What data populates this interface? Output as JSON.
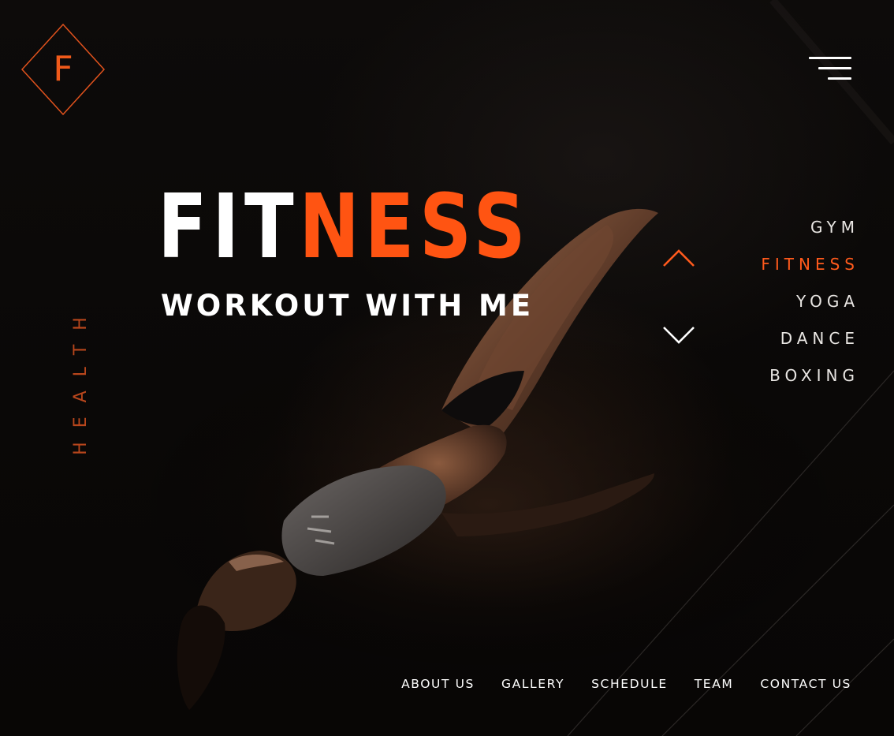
{
  "brand": {
    "logo_letter": "F",
    "accent_color": "#ff5412"
  },
  "header": {
    "menu_icon": "hamburger-menu-icon"
  },
  "side_label": "HEALTH",
  "hero": {
    "title_part1": "FIT",
    "title_part2": "NESS",
    "subtitle": "WORKOUT WITH ME",
    "photo_alt": "woman lying on floor"
  },
  "category_nav": {
    "up_icon": "chevron-up-icon",
    "down_icon": "chevron-down-icon",
    "items": [
      {
        "label": "GYM",
        "active": false
      },
      {
        "label": "FITNESS",
        "active": true
      },
      {
        "label": "YOGA",
        "active": false
      },
      {
        "label": "DANCE",
        "active": false
      },
      {
        "label": "BOXING",
        "active": false
      }
    ]
  },
  "footer_nav": {
    "items": [
      {
        "label": "ABOUT US"
      },
      {
        "label": "GALLERY"
      },
      {
        "label": "SCHEDULE"
      },
      {
        "label": "TEAM"
      },
      {
        "label": "CONTACT US"
      }
    ]
  }
}
